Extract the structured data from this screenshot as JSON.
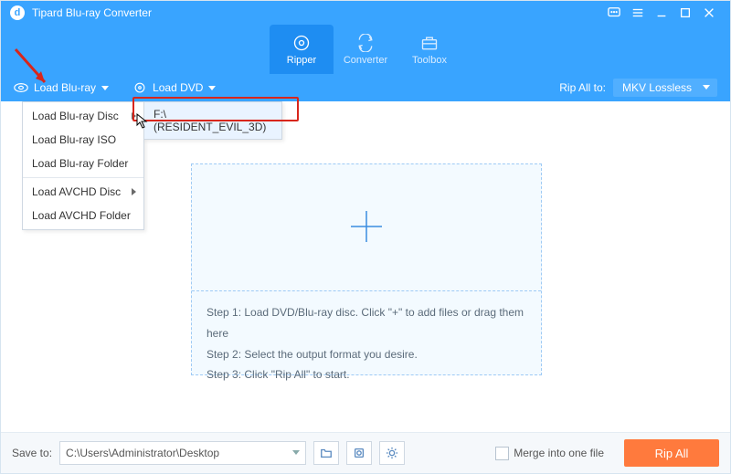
{
  "titlebar": {
    "app_name": "Tipard Blu-ray Converter"
  },
  "nav": {
    "tabs": [
      {
        "label": "Ripper"
      },
      {
        "label": "Converter"
      },
      {
        "label": "Toolbox"
      }
    ]
  },
  "toolrow": {
    "load_bluray": "Load Blu-ray",
    "load_dvd": "Load DVD",
    "rip_all_label": "Rip All to:",
    "rip_all_value": "MKV Lossless"
  },
  "menu": {
    "items": [
      {
        "label": "Load Blu-ray Disc"
      },
      {
        "label": "Load Blu-ray ISO"
      },
      {
        "label": "Load Blu-ray Folder"
      }
    ],
    "avchd": [
      {
        "label": "Load AVCHD Disc"
      },
      {
        "label": "Load AVCHD Folder"
      }
    ],
    "flyout": {
      "disc": "F:\\ (RESIDENT_EVIL_3D)"
    }
  },
  "dropzone": {
    "step1": "Step 1: Load DVD/Blu-ray disc. Click \"+\" to add files or drag them here",
    "step2": "Step 2: Select the output format you desire.",
    "step3": "Step 3: Click \"Rip All\" to start."
  },
  "bottom": {
    "save_to_label": "Save to:",
    "save_to_path": "C:\\Users\\Administrator\\Desktop",
    "merge_label": "Merge into one file",
    "rip_all_btn": "Rip All"
  }
}
